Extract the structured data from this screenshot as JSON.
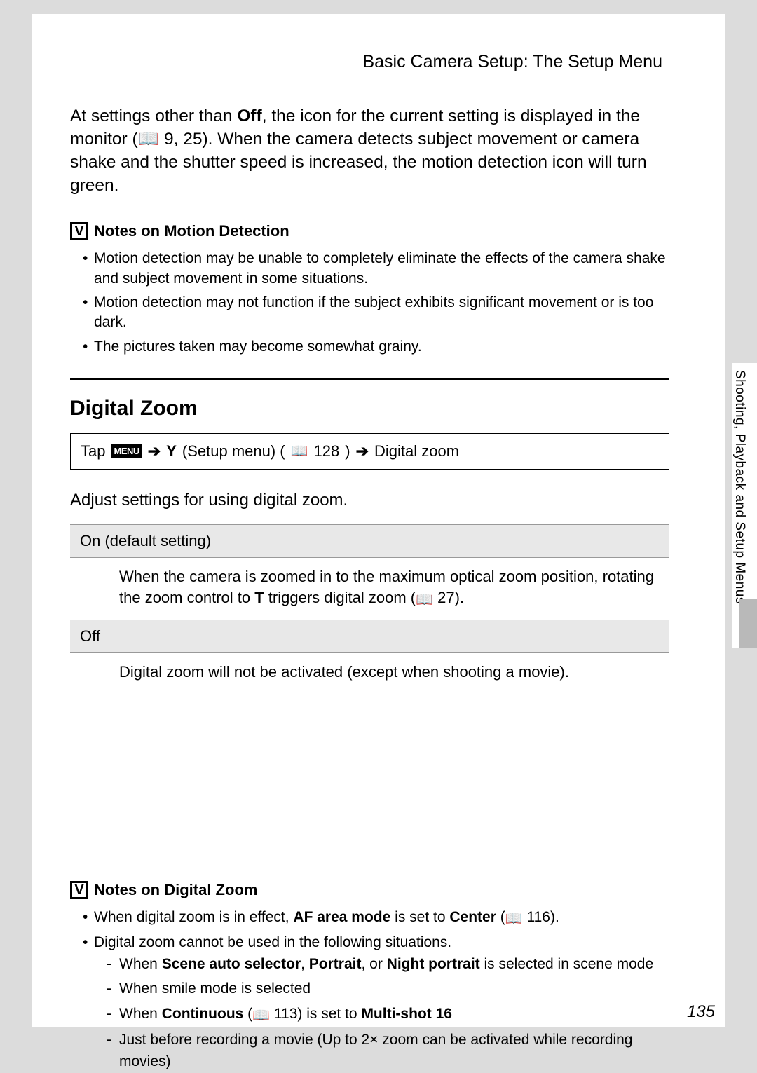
{
  "header": "Basic Camera Setup: The Setup Menu",
  "para1": {
    "pre": "At settings other than ",
    "bold": "Off",
    "post": ", the icon for the current setting is displayed in the monitor (📖 9, 25). When the camera detects subject movement or camera shake and the shutter speed is increased, the motion detection icon will turn green."
  },
  "notes1": {
    "title": "Notes on Motion Detection",
    "items": [
      "Motion detection may be unable to completely eliminate the effects of the camera shake and subject movement in some situations.",
      "Motion detection may not function if the subject exhibits significant movement or is too dark.",
      "The pictures taken may become somewhat grainy."
    ]
  },
  "section": {
    "title": "Digital Zoom",
    "nav": {
      "tap": "Tap",
      "menu_badge": "MENU",
      "setup_label": "(Setup menu) (",
      "ref1": "128",
      "end": ") ",
      "target": "Digital zoom"
    },
    "desc": "Adjust settings for using digital zoom.",
    "options": [
      {
        "name": "On (default setting)",
        "body_pre": "When the camera is zoomed in to the maximum optical zoom position, rotating the zoom control to ",
        "body_bold": "T",
        "body_mid": " triggers digital zoom (",
        "body_ref": "27",
        "body_post": ")."
      },
      {
        "name": "Off",
        "body_plain": "Digital zoom will not be activated (except when shooting a movie)."
      }
    ]
  },
  "sidebar": "Shooting, Playback and Setup Menus",
  "notes2": {
    "title": "Notes on Digital Zoom",
    "bullet1": {
      "pre": "When digital zoom is in effect, ",
      "b1": "AF area mode",
      "mid": " is set to ",
      "b2": "Center",
      "post": " (",
      "ref": "116",
      "end": ")."
    },
    "bullet2": "Digital zoom cannot be used in the following situations.",
    "subs": [
      {
        "pre": "When ",
        "b": "Scene auto selector",
        "mid": ", ",
        "b2": "Portrait",
        "mid2": ", or ",
        "b3": "Night portrait",
        "post": " is selected in scene mode"
      },
      {
        "plain": "When smile mode is selected"
      },
      {
        "pre": "When ",
        "b": "Continuous",
        "mid": " (",
        "ref": "113",
        "mid2": ") is set to ",
        "b2": "Multi-shot 16",
        "post": ""
      },
      {
        "plain": "Just before recording a movie (Up to 2× zoom can be activated while recording movies)"
      }
    ]
  },
  "pagenum": "135"
}
